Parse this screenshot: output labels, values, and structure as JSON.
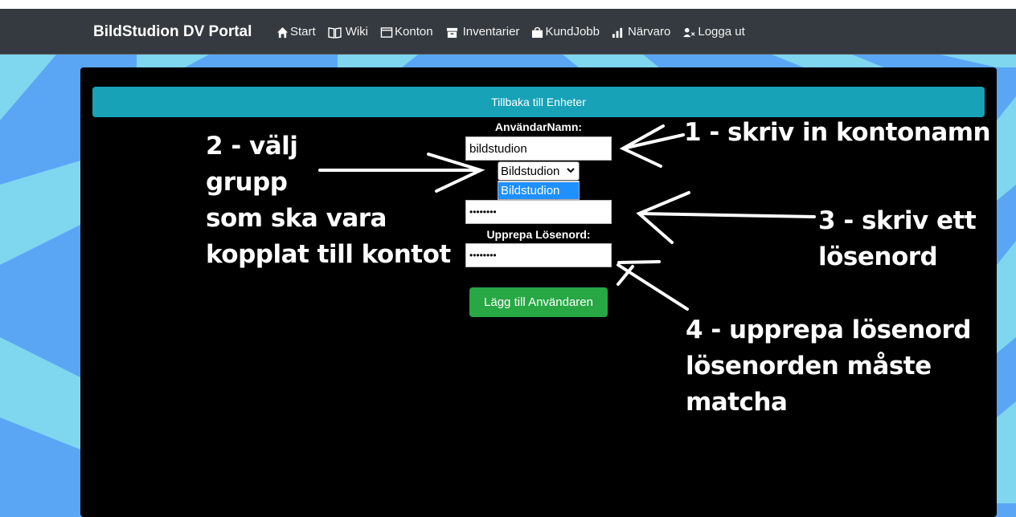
{
  "nav": {
    "brand": "BildStudion DV Portal",
    "items": [
      {
        "label": "Start",
        "icon": "home-icon"
      },
      {
        "label": "Wiki",
        "icon": "book-icon"
      },
      {
        "label": "Konton",
        "icon": "window-icon"
      },
      {
        "label": "Inventarier",
        "icon": "archive-icon"
      },
      {
        "label": "KundJobb",
        "icon": "bag-icon"
      },
      {
        "label": "Närvaro",
        "icon": "bar-chart-icon"
      },
      {
        "label": "Logga ut",
        "icon": "user-x-icon"
      }
    ]
  },
  "form": {
    "back_label": "Tillbaka till Enheter",
    "username_label": "AnvändarNamn:",
    "username_value": "bildstudion",
    "group_selected": "Bildstudion",
    "group_options": [
      "Bildstudion"
    ],
    "password_value": "••••••••",
    "repeat_label": "Upprepa Lösenord:",
    "repeat_value": "••••••••",
    "submit_label": "Lägg till Användaren"
  },
  "annotations": {
    "step1": "1 - skriv in kontonamn",
    "step2": [
      "2 - välj",
      "grupp",
      "som ska vara",
      "kopplat till kontot"
    ],
    "step3": [
      "3 - skriv ett",
      "lösenord"
    ],
    "step4": [
      "4 - upprepa lösenord",
      "lösenorden måste",
      "matcha"
    ]
  },
  "colors": {
    "navbar": "#343a40",
    "back_button": "#17a2b8",
    "submit_button": "#28a745",
    "bg_light": "#7fd6ef",
    "bg_dark": "#5aa6f5"
  }
}
